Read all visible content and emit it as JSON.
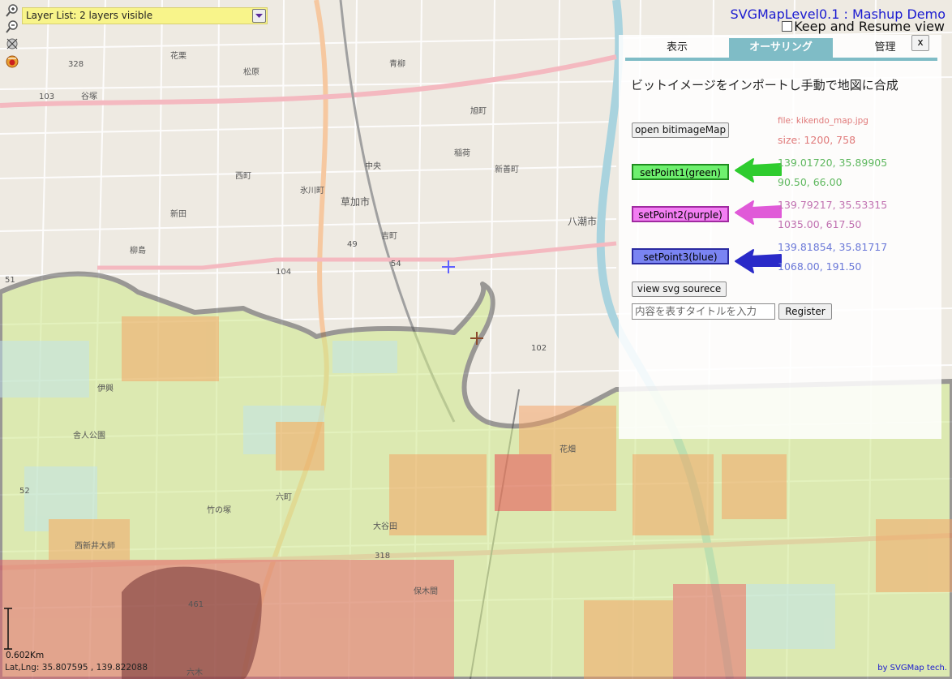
{
  "toolbar": {
    "icons": [
      "zoom-in-icon",
      "zoom-out-icon",
      "gps-icon",
      "layer-icon"
    ]
  },
  "layer_list": {
    "label": "Layer List: 2 layers visible"
  },
  "header": {
    "title": "SVGMapLevel0.1 : Mashup Demo",
    "keep_resume": "Keep and Resume view"
  },
  "panel": {
    "tabs": [
      "表示",
      "オーサリング",
      "管理"
    ],
    "active_tab": 1,
    "close_label": "x",
    "heading": "ビットイメージをインポートし手動で地図に合成",
    "open_button": "open bitimageMap",
    "file_name": "file: kikendo_map.jpg",
    "file_size": "size: 1200, 758",
    "points": [
      {
        "label": "setPoint1(green)",
        "geo": "139.01720, 35.89905",
        "px": "90.50, 66.00",
        "btn_bg": "#6ef06e",
        "btn_border": "#1e8c1e",
        "text_color": "#5fb85f",
        "arrow_color": "#2ecc2e"
      },
      {
        "label": "setPoint2(purple)",
        "geo": "139.79217, 35.53315",
        "px": "1035.00, 617.50",
        "btn_bg": "#f27ef2",
        "btn_border": "#a02aa0",
        "text_color": "#c070b0",
        "arrow_color": "#e05ad8"
      },
      {
        "label": "setPoint3(blue)",
        "geo": "139.81854, 35.81717",
        "px": "1068.00, 191.50",
        "btn_bg": "#7a84f2",
        "btn_border": "#2a2aa0",
        "text_color": "#6a78d8",
        "arrow_color": "#2a2ac8"
      }
    ],
    "view_svg_button": "view svg sourece",
    "title_placeholder": "内容を表すタイトルを入力",
    "register_button": "Register"
  },
  "footer": {
    "scale": "0.602Km",
    "latlng": "Lat,Lng: 35.807595 , 139.822088",
    "credit": "by SVGMap tech."
  },
  "map": {
    "labels": [
      "草加市",
      "八潮市",
      "西町",
      "新田",
      "谷塚",
      "柳島",
      "中央",
      "吉町",
      "新善町",
      "松原",
      "花栗",
      "青柳",
      "旭町",
      "稲荷",
      "氷川町",
      "六町",
      "舎人公園",
      "西新井大師",
      "伊興",
      "竹の塚",
      "保木間",
      "花畑",
      "大谷田",
      "六木"
    ],
    "road_numbers": [
      "49",
      "51",
      "54",
      "103",
      "104",
      "102",
      "318",
      "461",
      "328",
      "52"
    ]
  }
}
